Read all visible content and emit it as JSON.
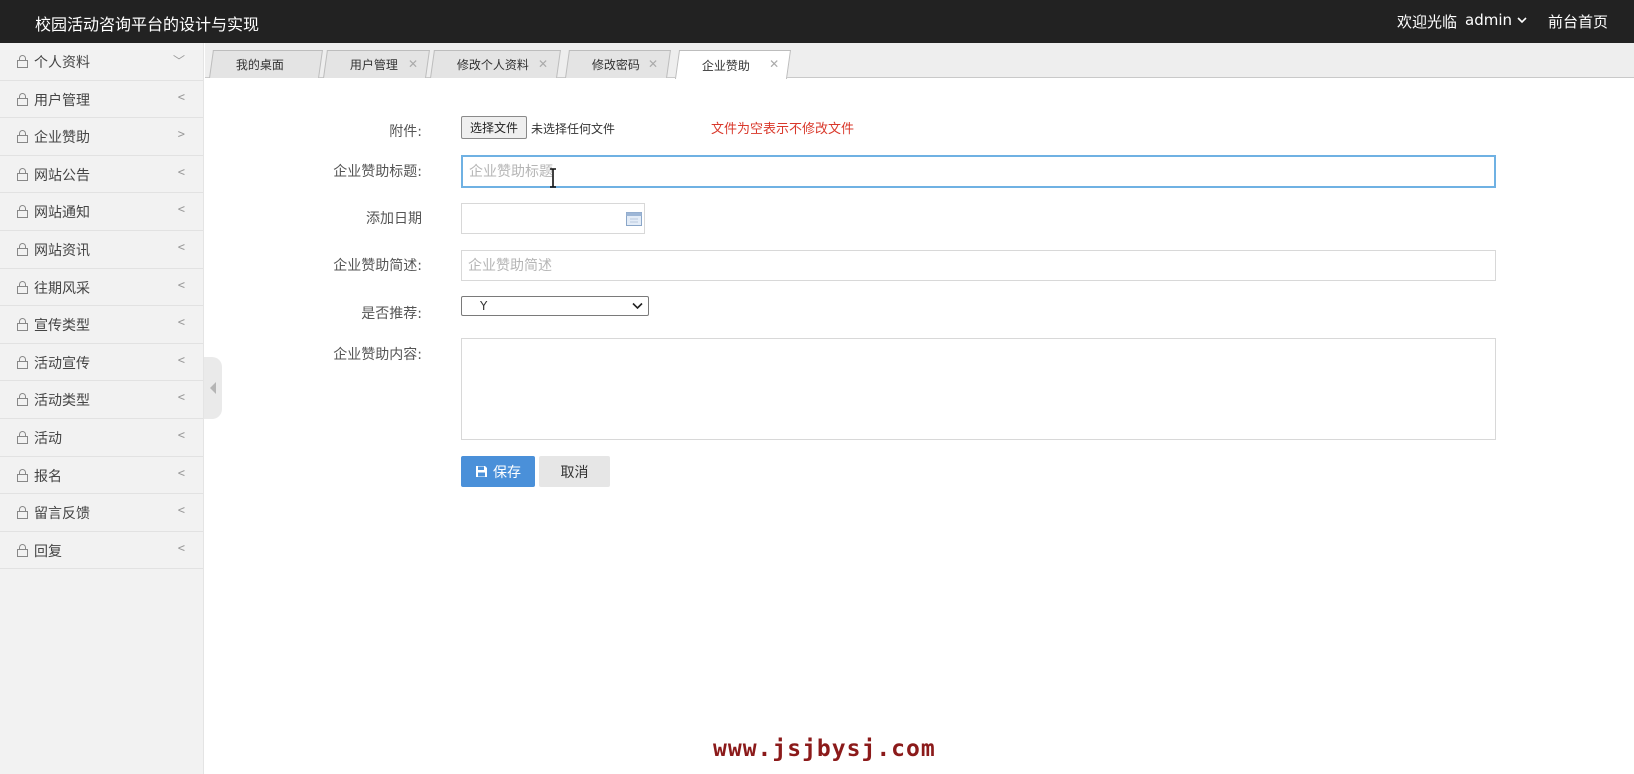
{
  "header": {
    "title": "校园活动咨询平台的设计与实现",
    "welcome": "欢迎光临",
    "username": "admin",
    "front_link": "前台首页"
  },
  "sidebar": {
    "items": [
      {
        "label": "个人资料",
        "arrow": "﹀"
      },
      {
        "label": "用户管理",
        "arrow": "<"
      },
      {
        "label": "企业赞助",
        "arrow": ">"
      },
      {
        "label": "网站公告",
        "arrow": "<"
      },
      {
        "label": "网站通知",
        "arrow": "<"
      },
      {
        "label": "网站资讯",
        "arrow": "<"
      },
      {
        "label": "往期风采",
        "arrow": "<"
      },
      {
        "label": "宣传类型",
        "arrow": "<"
      },
      {
        "label": "活动宣传",
        "arrow": "<"
      },
      {
        "label": "活动类型",
        "arrow": "<"
      },
      {
        "label": "活动",
        "arrow": "<"
      },
      {
        "label": "报名",
        "arrow": "<"
      },
      {
        "label": "留言反馈",
        "arrow": "<"
      },
      {
        "label": "回复",
        "arrow": "<"
      }
    ]
  },
  "tabs": [
    {
      "label": "我的桌面",
      "closable": false,
      "active": false
    },
    {
      "label": "用户管理",
      "closable": true,
      "active": false
    },
    {
      "label": "修改个人资料",
      "closable": true,
      "active": false
    },
    {
      "label": "修改密码",
      "closable": true,
      "active": false
    },
    {
      "label": "企业赞助",
      "closable": true,
      "active": true
    }
  ],
  "form": {
    "attachment": {
      "label": "附件:",
      "button": "选择文件",
      "status": "未选择任何文件",
      "hint": "文件为空表示不修改文件"
    },
    "title": {
      "label": "企业赞助标题:",
      "placeholder": "企业赞助标题",
      "value": ""
    },
    "date": {
      "label": "添加日期",
      "value": ""
    },
    "summary": {
      "label": "企业赞助简述:",
      "placeholder": "企业赞助简述",
      "value": ""
    },
    "recommend": {
      "label": "是否推荐:",
      "selected": "Y"
    },
    "content": {
      "label": "企业赞助内容:",
      "value": ""
    },
    "save_label": "保存",
    "cancel_label": "取消"
  },
  "watermark": "www.jsjbysj.com",
  "colors": {
    "topbar": "#222222",
    "accent": "#4a90d9",
    "hint": "#d9382b",
    "watermark": "#8b1a1a"
  }
}
